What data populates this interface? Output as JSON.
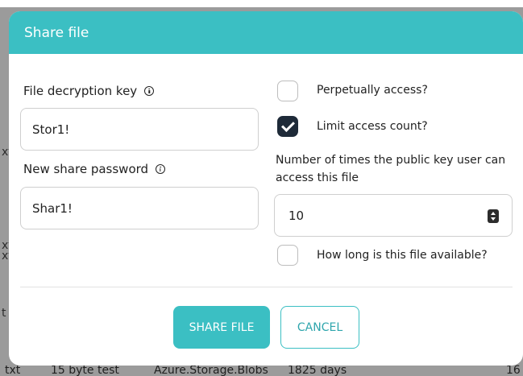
{
  "background": {
    "row": {
      "name": "txt",
      "description": "15 byte test",
      "type": "Azure.Storage.Blobs",
      "duration": "1825 days",
      "count": "16"
    },
    "fragments": [
      "xt",
      "xt",
      "xt",
      "t"
    ]
  },
  "modal": {
    "title": "Share file",
    "decryption_key": {
      "label": "File decryption key",
      "value": "Stor1!"
    },
    "share_password": {
      "label": "New share password",
      "value": "Shar1!"
    },
    "perpetual": {
      "label": "Perpetually access?",
      "checked": false
    },
    "limit_count": {
      "label": "Limit access count?",
      "checked": true
    },
    "access_count": {
      "label": "Number of times the public key user can access this file",
      "value": "10"
    },
    "availability": {
      "label": "How long is this file available?",
      "checked": false
    },
    "buttons": {
      "share": "SHARE FILE",
      "cancel": "CANCEL"
    }
  },
  "colors": {
    "accent": "#3bbfc3",
    "checkbox_checked": "#1e2a38"
  }
}
